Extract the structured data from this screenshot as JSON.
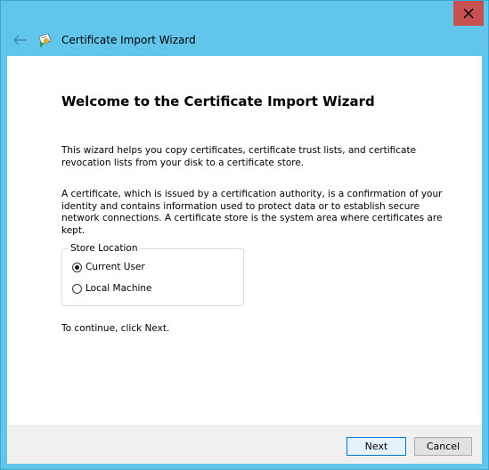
{
  "window": {
    "title": "Certificate Import Wizard",
    "close_symbol": "×",
    "colors": {
      "titlebar": "#62c5ea",
      "close": "#c75050"
    }
  },
  "icons": {
    "back": "back-arrow-icon",
    "title": "certificate-icon",
    "close": "close-icon"
  },
  "content": {
    "heading": "Welcome to the Certificate Import Wizard",
    "paragraph1": "This wizard helps you copy certificates, certificate trust lists, and certificate revocation lists from your disk to a certificate store.",
    "paragraph2": "A certificate, which is issued by a certification authority, is a confirmation of your identity and contains information used to protect data or to establish secure network connections. A certificate store is the system area where certificates are kept.",
    "store_location": {
      "label": "Store Location",
      "options": [
        "Current User",
        "Local Machine"
      ],
      "selected": "Current User"
    },
    "continue_text": "To continue, click Next."
  },
  "footer": {
    "next_label": "Next",
    "cancel_label": "Cancel"
  }
}
